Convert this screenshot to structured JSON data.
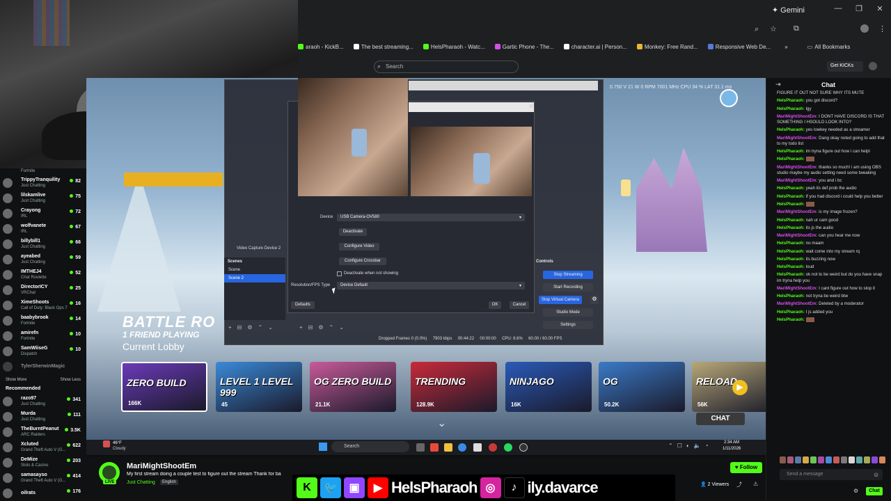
{
  "browser": {
    "gemini_label": "Gemini",
    "bookmarks": [
      {
        "label": "araoh - KickB...",
        "color": "#53fc18"
      },
      {
        "label": "The best streaming...",
        "color": "#ffffff"
      },
      {
        "label": "HelsPharaoh - Watc...",
        "color": "#53fc18"
      },
      {
        "label": "Gartic Phone - The...",
        "color": "#d54fe8"
      },
      {
        "label": "character.ai | Person...",
        "color": "#ffffff"
      },
      {
        "label": "Monkey: Free Rand...",
        "color": "#e8b830"
      },
      {
        "label": "Responsive Web De...",
        "color": "#5a7ad8"
      }
    ],
    "all_bookmarks": "All Bookmarks",
    "search_placeholder": "Search",
    "get_kicks": "Get KICKs"
  },
  "sidebar": {
    "top_game": "Fortnite",
    "channels": [
      {
        "name": "TrippyTranquility",
        "game": "Just Chatting",
        "count": "82"
      },
      {
        "name": "lilskamlive",
        "game": "Just Chatting",
        "count": "75"
      },
      {
        "name": "Crayong",
        "game": "IRL",
        "count": "72"
      },
      {
        "name": "wolfvanete",
        "game": "IRL",
        "count": "67"
      },
      {
        "name": "billybill1",
        "game": "Just Chatting",
        "count": "66"
      },
      {
        "name": "ayeabed",
        "game": "Just Chatting",
        "count": "59"
      },
      {
        "name": "IMTHEJ4",
        "game": "Chat Roulette",
        "count": "52"
      },
      {
        "name": "DirectorICY",
        "game": "VRChat",
        "count": "25"
      },
      {
        "name": "XimeShoots",
        "game": "Call of Duty: Black Ops 7",
        "count": "16"
      },
      {
        "name": "baabybrook",
        "game": "Fortnite",
        "count": "14"
      },
      {
        "name": "amirefn",
        "game": "Fortnite",
        "count": "10"
      },
      {
        "name": "SamWiiseG",
        "game": "Dispatch",
        "count": "10"
      },
      {
        "name": "TylerSherwinMagic",
        "game": "",
        "count": ""
      }
    ],
    "show_more": "Show More",
    "show_less": "Show Less",
    "recommended": "Recommended",
    "recommended_channels": [
      {
        "name": "razo97",
        "game": "Just Chatting",
        "count": "341"
      },
      {
        "name": "Murda",
        "game": "Just Chatting",
        "count": "111"
      },
      {
        "name": "TheBurntPeanut",
        "game": "ARC Raiders",
        "count": "3.5K"
      },
      {
        "name": "Xcluted",
        "game": "Grand Theft Auto V (G...",
        "count": "622"
      },
      {
        "name": "DeMize",
        "game": "Slots & Casino",
        "count": "203"
      },
      {
        "name": "samasayso",
        "game": "Grand Theft Auto V (G...",
        "count": "414"
      },
      {
        "name": "oilrats",
        "game": "",
        "count": "176"
      }
    ]
  },
  "game": {
    "battle_royale": "BATTLE RO",
    "friend_playing": "1  FRIEND PLAYING",
    "current_lobby": "Current Lobby",
    "tiles": [
      {
        "title": "ZERO BUILD",
        "count": "166K",
        "color": "#6a3ab8"
      },
      {
        "title": "LEVEL 1 LEVEL 999",
        "count": "45",
        "color": "#3a8ad8"
      },
      {
        "title": "OG ZERO BUILD",
        "count": "21.1K",
        "color": "#c85a9a"
      },
      {
        "title": "TRENDING",
        "count": "128.9K",
        "color": "#c82a3a"
      },
      {
        "title": "NINJAGO",
        "count": "16K",
        "color": "#2a5ab8"
      },
      {
        "title": "OG",
        "count": "50.2K",
        "color": "#3a7ac8"
      },
      {
        "title": "RELOAD",
        "count": "56K",
        "color": "#b8a878"
      }
    ],
    "chat_button": "CHAT"
  },
  "obs": {
    "stats": "0.750 V  21 W  0 RPM  7001 MHz     CPU 34 %     LAT 31.1 ms",
    "device_label": "Device",
    "device_value": "USB Camera-OV580",
    "deactivate": "Deactivate",
    "configure_video": "Configure Video",
    "configure_crossbar": "Configure Crossbar",
    "deactivate_when": "Deactivate when not showing",
    "resolution_label": "Resolution/FPS Type",
    "resolution_value": "Device Default",
    "defaults": "Defaults",
    "ok": "OK",
    "cancel": "Cancel",
    "source_label": "Video Capture Device 2",
    "scenes_header": "Scenes",
    "scenes": [
      "Scene",
      "Scene 2"
    ],
    "controls_header": "Controls",
    "stop_streaming": "Stop Streaming",
    "start_recording": "Start Recording",
    "stop_virtual_camera": "Stop Virtual Camera",
    "studio_mode": "Studio Mode",
    "settings": "Settings",
    "status_bar": "Dropped Frames 0 (0.0%)     7903 kbps     00:44:22     00:00:00     CPU: 8.6%     60.00 / 60.00 FPS"
  },
  "taskbar": {
    "weather": "46°F",
    "weather_desc": "Cloudy",
    "search": "Search",
    "time": "2:34 AM",
    "date": "1/11/2026"
  },
  "stream": {
    "streamer": "MariMightShootEm",
    "title": "My first stream doing a couple test to figure out the stream Thank for ba",
    "category": "Just Chatting",
    "language": "English",
    "live": "LIVE",
    "follow": "Follow",
    "viewers": "2 Viewers",
    "social_handle_1": "HelsPharaoh",
    "social_handle_2": "ily.davarce"
  },
  "chat": {
    "header": "Chat",
    "messages": [
      {
        "user": "",
        "text": "FIGURE IT OUT NOT SURE WHY ITS MUTE",
        "type": "plain"
      },
      {
        "user": "HelsPharaoh:",
        "text": "you got discord?",
        "type": "u1"
      },
      {
        "user": "HelsPharaoh:",
        "text": "lgy",
        "type": "u1"
      },
      {
        "user": "MariMightShootEm:",
        "text": "I DONT HAVE DISCORD IS THAT SOMETHING I HSOULD LOOK INTO?",
        "type": "u2"
      },
      {
        "user": "HelsPharaoh:",
        "text": "yes lowkey needed as a streamer",
        "type": "u1"
      },
      {
        "user": "MariMightShootEm:",
        "text": "Dang okay noted going to add that to my todo list",
        "type": "u2"
      },
      {
        "user": "HelsPharaoh:",
        "text": "im tryna figure out how i can help\\",
        "type": "u1"
      },
      {
        "user": "HelsPharaoh:",
        "text": "",
        "type": "u1"
      },
      {
        "user": "MariMightShootEm:",
        "text": "thanks so much! i am using OBS studio maybe my audio setting need some tweaking",
        "type": "u2"
      },
      {
        "user": "MariMightShootEm:",
        "text": "you and i bc",
        "type": "u2"
      },
      {
        "user": "HelsPharaoh:",
        "text": "yeah its def prob the audio",
        "type": "u1"
      },
      {
        "user": "HelsPharaoh:",
        "text": "if you had discord i could help you better",
        "type": "u1"
      },
      {
        "user": "HelsPharaoh:",
        "text": "",
        "type": "u1"
      },
      {
        "user": "MariMightShootEm:",
        "text": "is my image frozen?",
        "type": "u2"
      },
      {
        "user": "HelsPharaoh:",
        "text": "nah ur cam good",
        "type": "u1"
      },
      {
        "user": "HelsPharaoh:",
        "text": "its js the audio",
        "type": "u1"
      },
      {
        "user": "MariMightShootEm:",
        "text": "can you hear me now",
        "type": "u2"
      },
      {
        "user": "HelsPharaoh:",
        "text": "no maam",
        "type": "u1"
      },
      {
        "user": "HelsPharaoh:",
        "text": "wait come into my stream rq",
        "type": "u1"
      },
      {
        "user": "HelsPharaoh:",
        "text": "its buzzing now",
        "type": "u1"
      },
      {
        "user": "HelsPharaoh:",
        "text": "loud",
        "type": "u1"
      },
      {
        "user": "HelsPharaoh:",
        "text": "ok not to be weird but do you have snap im tryna help you",
        "type": "u1"
      },
      {
        "user": "MariMightShootEm:",
        "text": "I cant figure out how to stop it",
        "type": "u2"
      },
      {
        "user": "HelsPharaoh:",
        "text": "not tryna be weird btw",
        "type": "u1"
      },
      {
        "user": "MariMightShootEm:",
        "text": "Deleted by a moderator",
        "type": "u2"
      },
      {
        "user": "HelsPharaoh:",
        "text": "I js added you",
        "type": "u1"
      },
      {
        "user": "HelsPharaoh:",
        "text": "",
        "type": "u1"
      }
    ],
    "send_placeholder": "Send a message",
    "send_button": "Chat"
  }
}
